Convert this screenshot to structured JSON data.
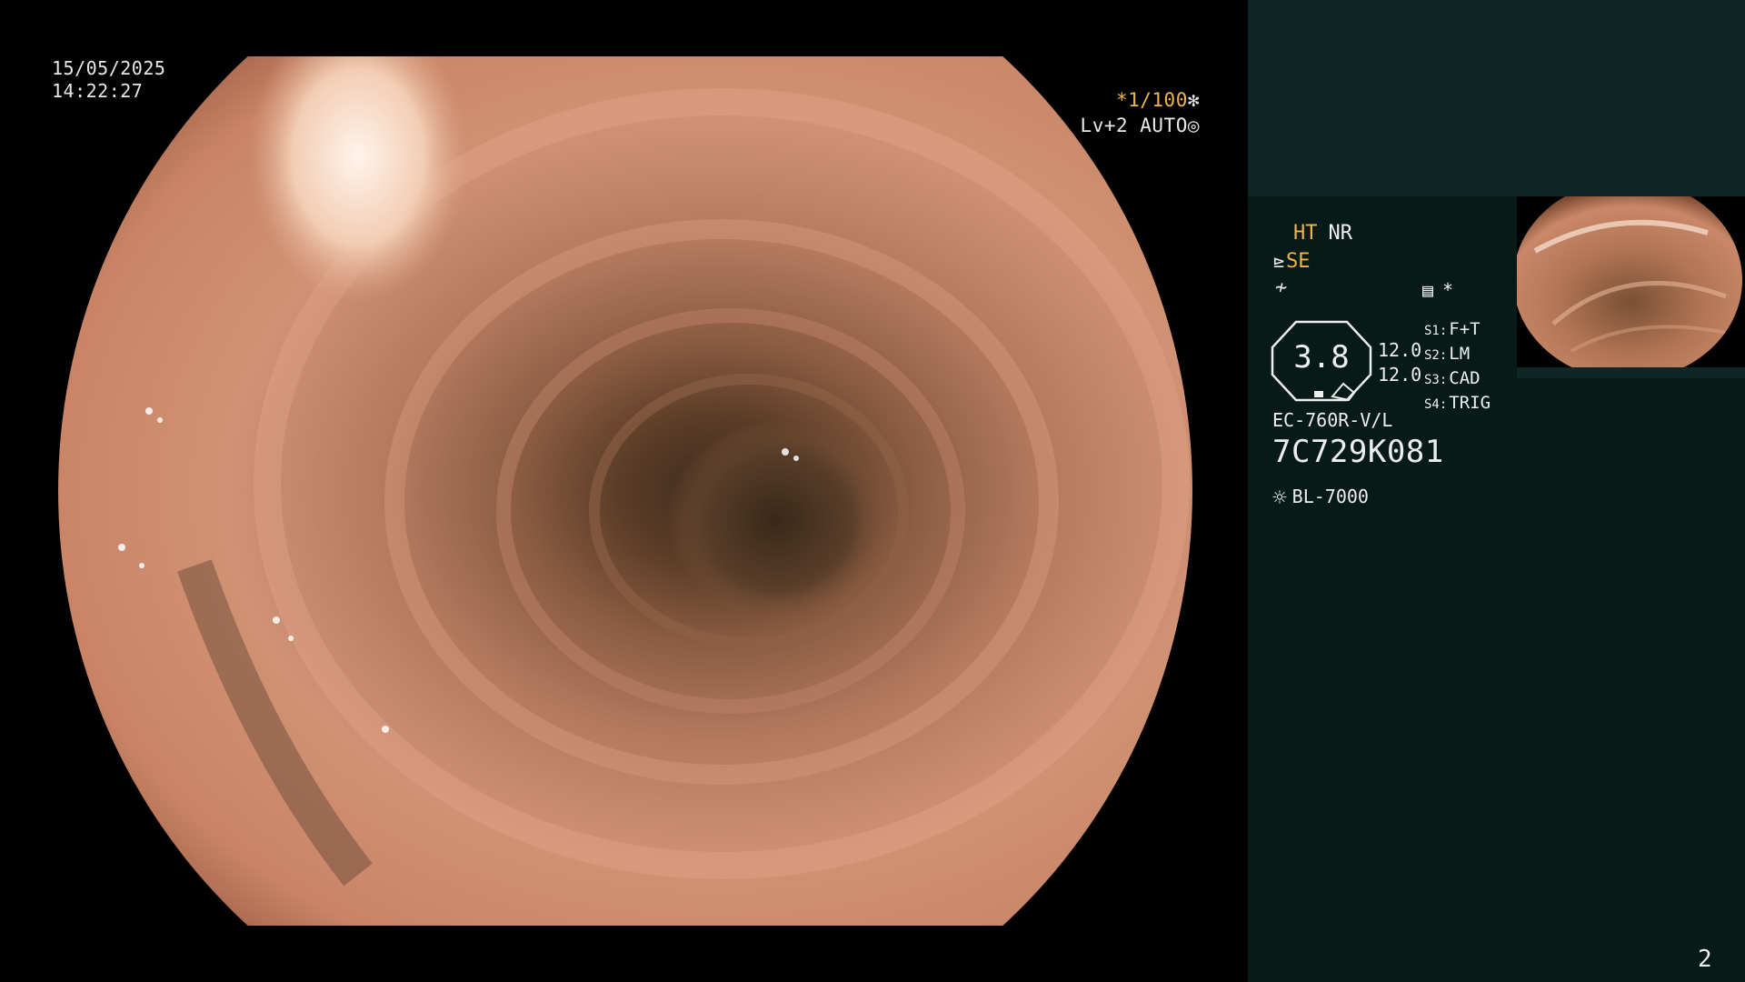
{
  "overlay": {
    "date": "15/05/2025",
    "time": "14:22:27",
    "shutter": "*1/100",
    "shutter_icon": "shutter-icon",
    "level": "Lv+2 AUTO",
    "level_icon": "iris-icon"
  },
  "panel": {
    "ht": "HT",
    "nr": "NR",
    "se": "SE",
    "se_icon": "structure-enhance-icon",
    "strike_icon": "strike-icon",
    "settings_icon": "settings-list-icon",
    "asterisk": "*",
    "center_value": "3.8",
    "value_a": "12.0",
    "value_b": "12.0",
    "slots": [
      {
        "key": "S1:",
        "value": "F+T"
      },
      {
        "key": "S2:",
        "value": "LM"
      },
      {
        "key": "S3:",
        "value": "CAD"
      },
      {
        "key": "S4:",
        "value": "TRIG"
      }
    ],
    "model": "EC-760R-V/L",
    "serial": "7C729K081",
    "light_source_icon": "light-source-icon",
    "light_source": "BL-7000",
    "page_number": "2"
  },
  "colors": {
    "panel_bg": "#061a17",
    "panel_top_bg": "#0e2624",
    "accent_orange": "#f0b44c",
    "text": "#eeeeee"
  }
}
